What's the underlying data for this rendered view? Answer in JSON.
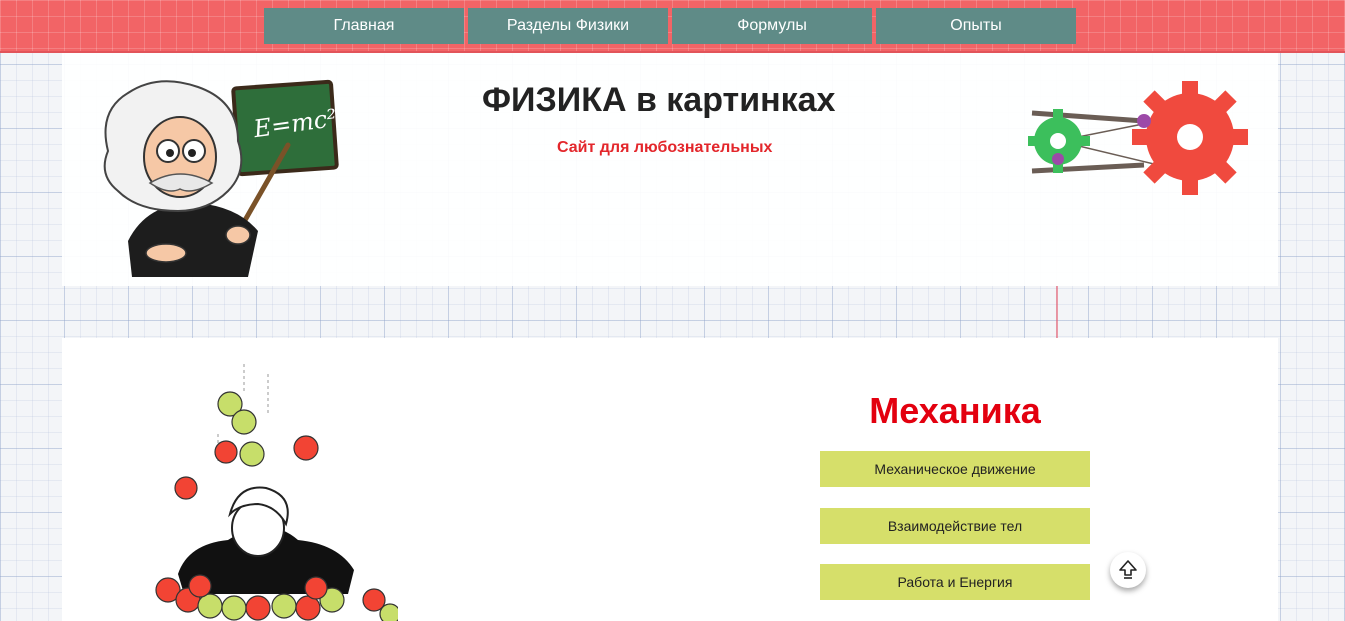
{
  "nav": {
    "items": [
      {
        "label": "Главная"
      },
      {
        "label": "Разделы Физики"
      },
      {
        "label": "Формулы"
      },
      {
        "label": "Опыты"
      }
    ]
  },
  "header": {
    "title": "ФИЗИКА в картинках",
    "subtitle": "Сайт для любознательных",
    "blackboard_text": "E=mc²"
  },
  "section": {
    "title": "Механика",
    "topics": [
      {
        "label": "Механическое движение"
      },
      {
        "label": "Взаимодействие тел"
      },
      {
        "label": "Работа и Енергия"
      }
    ]
  },
  "icons": {
    "scroll_top": "arrow-up-icon"
  },
  "colors": {
    "topbar": "#f26466",
    "nav_button": "#5f8b87",
    "accent_red": "#e3262b",
    "topic_button": "#d6df6a"
  }
}
